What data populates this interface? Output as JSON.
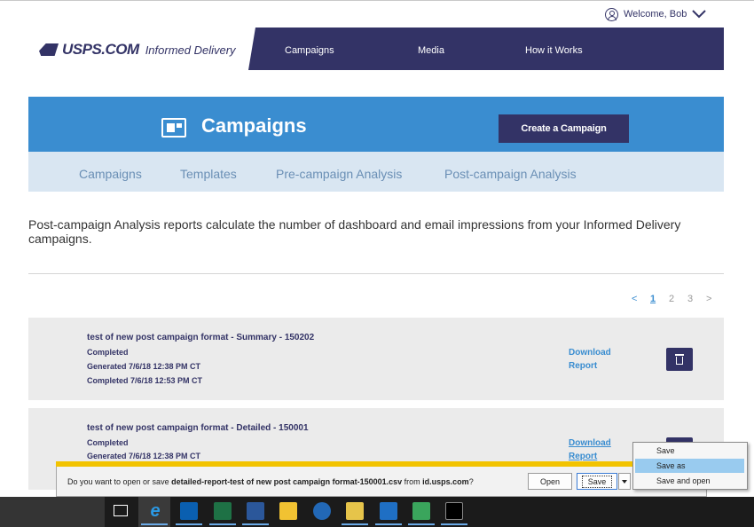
{
  "header": {
    "welcome": "Welcome, Bob",
    "logo_brand": "USPS.COM",
    "logo_product": "Informed Delivery",
    "nav": [
      "Campaigns",
      "Media",
      "How it Works"
    ]
  },
  "banner": {
    "title": "Campaigns",
    "create_button": "Create a Campaign"
  },
  "subnav": [
    "Campaigns",
    "Templates",
    "Pre-campaign Analysis",
    "Post-campaign Analysis"
  ],
  "description": "Post-campaign Analysis reports calculate the number of dashboard and email impressions from your Informed Delivery campaigns.",
  "pagination": {
    "prev": "<",
    "pages": [
      "1",
      "2",
      "3"
    ],
    "current": "1",
    "next": ">"
  },
  "reports": [
    {
      "title": "test of new post campaign format - Summary - 150202",
      "status": "Completed",
      "generated": "Generated 7/6/18 12:38 PM CT",
      "completed": "Completed 7/6/18 12:53 PM CT",
      "download_line1": "Download",
      "download_line2": "Report"
    },
    {
      "title": "test of new post campaign format - Detailed - 150001",
      "status": "Completed",
      "generated": "Generated 7/6/18 12:38 PM CT",
      "download_line1": "Download",
      "download_line2": "Report"
    }
  ],
  "download_bar": {
    "prefix": "Do you want to open or save ",
    "filename": "detailed-report-test of new post campaign format-150001.csv",
    "middle": " from ",
    "domain": "id.usps.com",
    "suffix": "?",
    "open": "Open",
    "save": "Save"
  },
  "save_menu": [
    "Save",
    "Save as",
    "Save and open"
  ],
  "taskbar_icons": [
    "task-view-icon",
    "internet-explorer-icon",
    "outlook-icon",
    "excel-icon",
    "word-icon",
    "file-explorer-icon",
    "r-icon",
    "folder-icon",
    "lync-icon",
    "media-icon",
    "terminal-icon"
  ],
  "colors": {
    "navy": "#333366",
    "blue": "#3a8dd0",
    "light_blue": "#d9e6f2"
  }
}
